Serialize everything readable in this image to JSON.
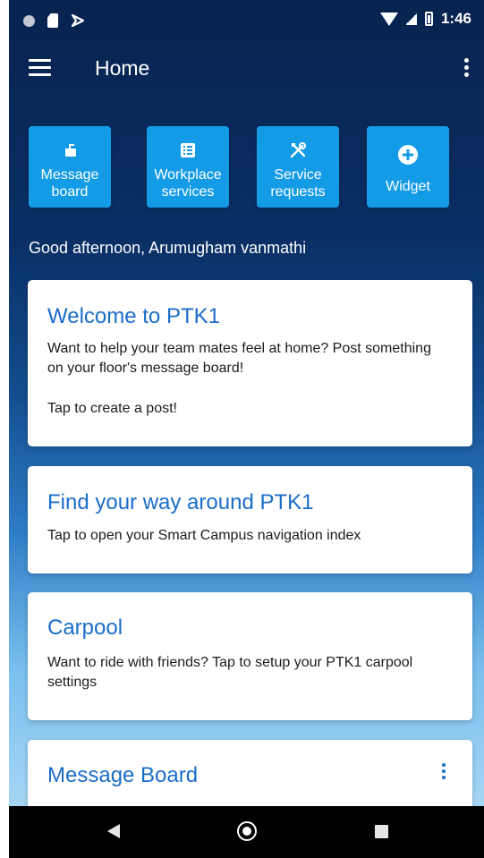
{
  "status_bar": {
    "time": "1:46",
    "left_icons": [
      "notification-dot-icon",
      "sd-card-icon",
      "download-icon"
    ],
    "right_icons": [
      "wifi-icon",
      "signal-icon",
      "battery-icon"
    ]
  },
  "app_bar": {
    "title": "Home",
    "menu_icon": "hamburger-menu-icon",
    "overflow_icon": "more-vertical-icon"
  },
  "tiles": [
    {
      "label": "Message board",
      "label_line1": "Message",
      "label_line2": "board",
      "icon": "message-board-icon"
    },
    {
      "label": "Workplace services",
      "label_line1": "Workplace",
      "label_line2": "services",
      "icon": "list-icon"
    },
    {
      "label": "Service requests",
      "label_line1": "Service",
      "label_line2": "requests",
      "icon": "tools-icon"
    },
    {
      "label": "Widget",
      "label_line1": "Widget",
      "label_line2": "",
      "icon": "add-circle-icon"
    }
  ],
  "greeting": "Good afternoon, Arumugham vanmathi",
  "cards": [
    {
      "title": "Welcome to PTK1",
      "text": "Want to help your team mates feel at home? Post something on your floor's message board!",
      "action": "Tap to create a post!"
    },
    {
      "title": "Find your way around PTK1",
      "text": "Tap to open your Smart Campus navigation index"
    },
    {
      "title": "Carpool",
      "text": "Want to ride with friends? Tap to setup your PTK1 carpool settings"
    },
    {
      "title": "Message Board",
      "more_icon": "more-vertical-icon"
    }
  ],
  "nav_bar": {
    "back_icon": "back-icon",
    "home_icon": "home-icon",
    "recent_icon": "recent-apps-icon"
  },
  "colors": {
    "background_top": "#07234f",
    "background_bottom": "#b7def7",
    "tile_blue": "#139be6",
    "card_title_blue": "#1a6dc8",
    "nav_bar": "#000000"
  }
}
